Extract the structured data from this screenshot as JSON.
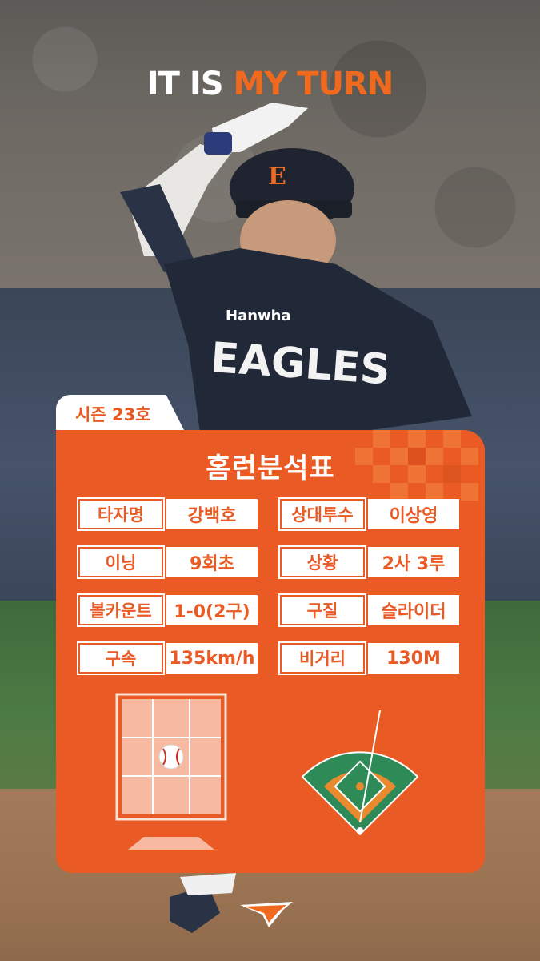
{
  "headline": {
    "part1": "IT IS ",
    "part2": "MY TURN"
  },
  "season_tag": "시즌 23호",
  "card_title": "홈런분석표",
  "stats": [
    {
      "label": "타자명",
      "value": "강백호"
    },
    {
      "label": "상대투수",
      "value": "이상영"
    },
    {
      "label": "이닝",
      "value": "9회초"
    },
    {
      "label": "상황",
      "value": "2사 3루"
    },
    {
      "label": "볼카운트",
      "value": "1-0(2구)"
    },
    {
      "label": "구질",
      "value": "슬라이더"
    },
    {
      "label": "구속",
      "value": "135km/h"
    },
    {
      "label": "비거리",
      "value": "130M"
    }
  ],
  "colors": {
    "accent": "#ea5a24",
    "headline_accent": "#ef6a1e",
    "field_green": "#2e8b57",
    "infield": "#e98a2e"
  },
  "icons": {
    "baseball": "baseball-icon",
    "logo": "eagles-logo"
  }
}
